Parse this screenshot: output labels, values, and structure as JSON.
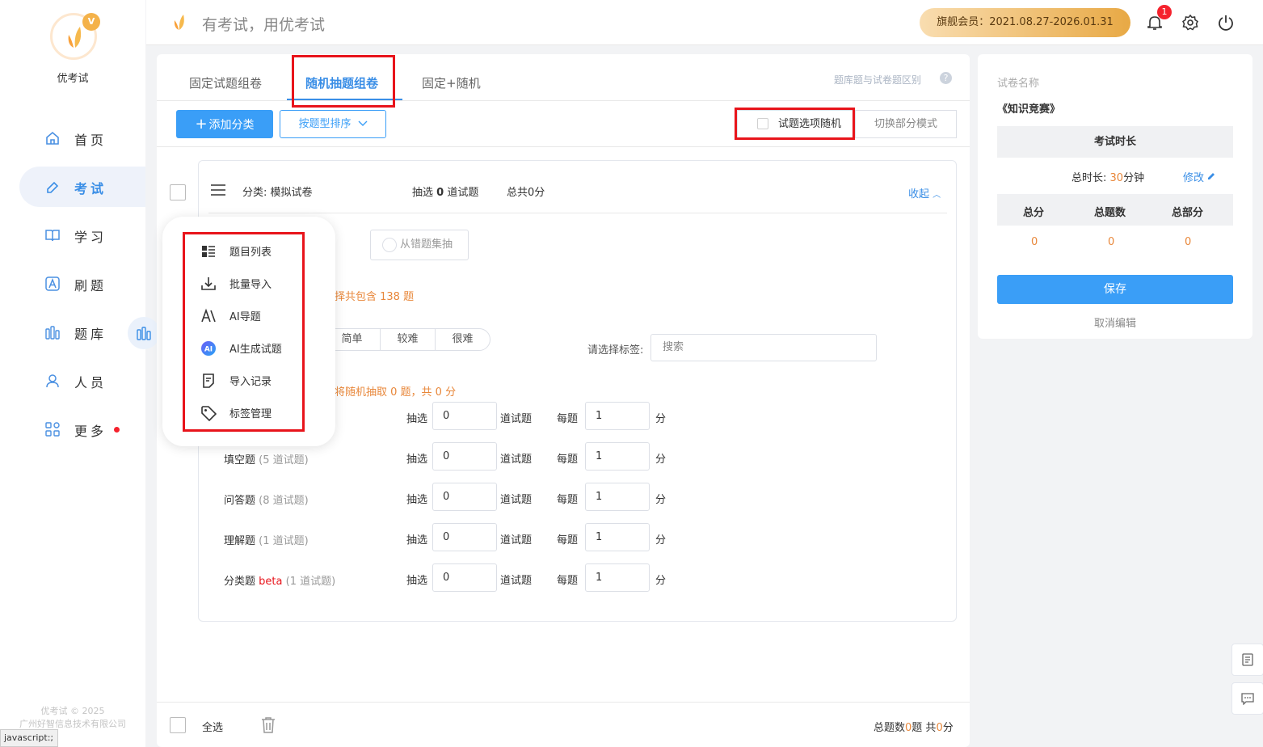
{
  "sidebar": {
    "brand": "优考试",
    "logo_badge": "V",
    "items": [
      {
        "label": "首页",
        "icon": "home-icon"
      },
      {
        "label": "考试",
        "icon": "exam-icon",
        "active": true
      },
      {
        "label": "学习",
        "icon": "book-icon"
      },
      {
        "label": "刷题",
        "icon": "practice-icon"
      },
      {
        "label": "题库",
        "icon": "question-bank-icon"
      },
      {
        "label": "人员",
        "icon": "user-icon"
      },
      {
        "label": "更多",
        "icon": "more-icon"
      }
    ],
    "copyright_line1": "优考试 © 2025",
    "copyright_line2": "广州好智信息技术有限公司"
  },
  "status_bar": "javascript:;",
  "header": {
    "slogan": "有考试，用优考试",
    "vip_label": "旗舰会员：2021.08.27-2026.01.31",
    "notification_count": "1"
  },
  "tabs": {
    "fixed": "固定试题组卷",
    "random": "随机抽题组卷",
    "mixed": "固定+随机",
    "help_link": "题库题与试卷题区别",
    "help_icon": "?"
  },
  "toolbar": {
    "add_category": "添加分类",
    "sort_by_type": "按题型排序",
    "option_random": "试题选项随机",
    "switch_mode": "切换部分模式"
  },
  "category": {
    "name": "分类: 模拟试卷",
    "pick_prefix": "抽选 ",
    "pick_count": "0",
    "pick_suffix": " 道试题",
    "total": "总共0分",
    "collapse": "收起",
    "from_wrong_set": "从错题集抽",
    "contains_note": "择共包含 138 题",
    "difficulty": [
      "简单",
      "较难",
      "很难"
    ],
    "tag_label": "请选择标签:",
    "tag_placeholder": "搜索",
    "random_note": "将随机抽取 0 题，共 0 分",
    "pick_label": "抽选",
    "unit_questions": "道试题",
    "each_label": "每题",
    "unit_points": "分",
    "rows": [
      {
        "type": "",
        "count": "",
        "beta": "",
        "pick": "0",
        "score": "1"
      },
      {
        "type": "填空题",
        "count": "(5 道试题)",
        "beta": "",
        "pick": "0",
        "score": "1"
      },
      {
        "type": "问答题",
        "count": "(8 道试题)",
        "beta": "",
        "pick": "0",
        "score": "1"
      },
      {
        "type": "理解题",
        "count": "(1 道试题)",
        "beta": "",
        "pick": "0",
        "score": "1"
      },
      {
        "type": "分类题",
        "count": "(1 道试题)",
        "beta": "beta",
        "pick": "0",
        "score": "1"
      }
    ]
  },
  "popup_menu": [
    {
      "label": "题目列表",
      "icon": "list-icon"
    },
    {
      "label": "批量导入",
      "icon": "download-icon"
    },
    {
      "label": "AI导题",
      "icon": "ai-import-icon"
    },
    {
      "label": "AI生成试题",
      "icon": "ai-generate-icon"
    },
    {
      "label": "导入记录",
      "icon": "record-icon"
    },
    {
      "label": "标签管理",
      "icon": "tag-icon"
    }
  ],
  "footer": {
    "select_all": "全选",
    "summary_prefix": "总题数",
    "summary_count": "0",
    "summary_mid": "题 共",
    "summary_points": "0",
    "summary_suffix": "分"
  },
  "right_panel": {
    "paper_label": "试卷名称",
    "paper_name": "《知识竞赛》",
    "duration_header": "考试时长",
    "duration_prefix": "总时长: ",
    "duration_value": "30",
    "duration_suffix": "分钟",
    "edit_link": "修改",
    "stats": [
      {
        "label": "总分",
        "value": "0"
      },
      {
        "label": "总题数",
        "value": "0"
      },
      {
        "label": "总部分",
        "value": "0"
      }
    ],
    "save": "保存",
    "cancel": "取消编辑"
  },
  "colors": {
    "accent": "#3a9ef7",
    "highlight_box": "#e8141b",
    "orange": "#e8873a"
  }
}
